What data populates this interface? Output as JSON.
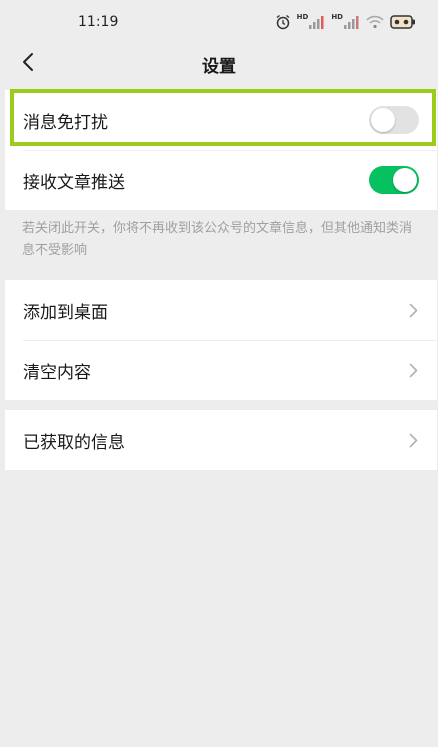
{
  "status_bar": {
    "time": "11:19",
    "hd1": "HD",
    "hd2": "HD",
    "icons": [
      "alarm-icon",
      "signal-icon",
      "signal-icon",
      "wifi-icon",
      "battery-icon"
    ]
  },
  "nav": {
    "title": "设置",
    "back_icon": "chevron-left-icon"
  },
  "settings": {
    "mute": {
      "label": "消息免打扰",
      "enabled": false
    },
    "receive": {
      "label": "接收文章推送",
      "enabled": true
    },
    "note": "若关闭此开关，你将不再收到该公众号的文章信息，但其他通知类消息不受影响",
    "add_desktop": {
      "label": "添加到桌面"
    },
    "clear": {
      "label": "清空内容"
    },
    "info": {
      "label": "已获取的信息"
    }
  },
  "colors": {
    "accent_green": "#07c160",
    "highlight_border": "#9ccc1a",
    "background": "#ededed"
  }
}
